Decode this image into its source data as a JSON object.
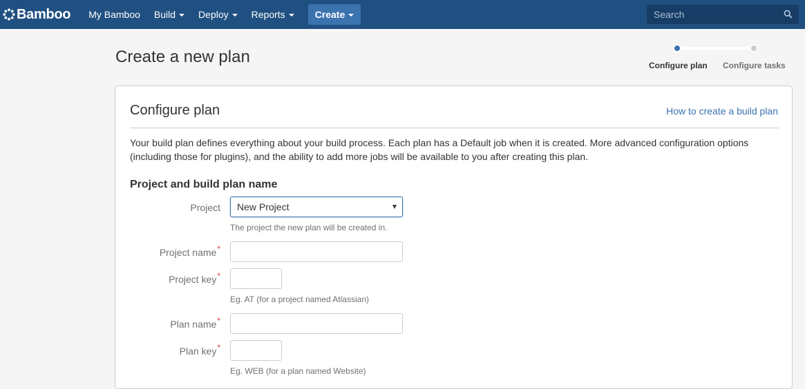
{
  "header": {
    "logo_text": "Bamboo",
    "nav": {
      "my_bamboo": "My Bamboo",
      "build": "Build",
      "deploy": "Deploy",
      "reports": "Reports",
      "create": "Create"
    },
    "search_placeholder": "Search",
    "colors": {
      "bar": "#205081",
      "create_button": "#3b73af"
    }
  },
  "page": {
    "title": "Create a new plan",
    "steps": [
      {
        "label": "Configure plan",
        "state": "current"
      },
      {
        "label": "Configure tasks",
        "state": "upcoming"
      }
    ]
  },
  "panel": {
    "title": "Configure plan",
    "help_link": "How to create a build plan",
    "intro": "Your build plan defines everything about your build process. Each plan has a Default job when it is created. More advanced configuration options (including those for plugins), and the ability to add more jobs will be available to you after creating this plan.",
    "section_title": "Project and build plan name",
    "fields": {
      "project": {
        "label": "Project",
        "value": "New Project",
        "description": "The project the new plan will be created in."
      },
      "project_name": {
        "label": "Project name",
        "required": "*",
        "value": ""
      },
      "project_key": {
        "label": "Project key",
        "required": "*",
        "value": "",
        "description": "Eg. AT (for a project named Atlassian)"
      },
      "plan_name": {
        "label": "Plan name",
        "required": "*",
        "value": ""
      },
      "plan_key": {
        "label": "Plan key",
        "required": "*",
        "value": "",
        "description": "Eg. WEB (for a plan named Website)"
      }
    }
  }
}
